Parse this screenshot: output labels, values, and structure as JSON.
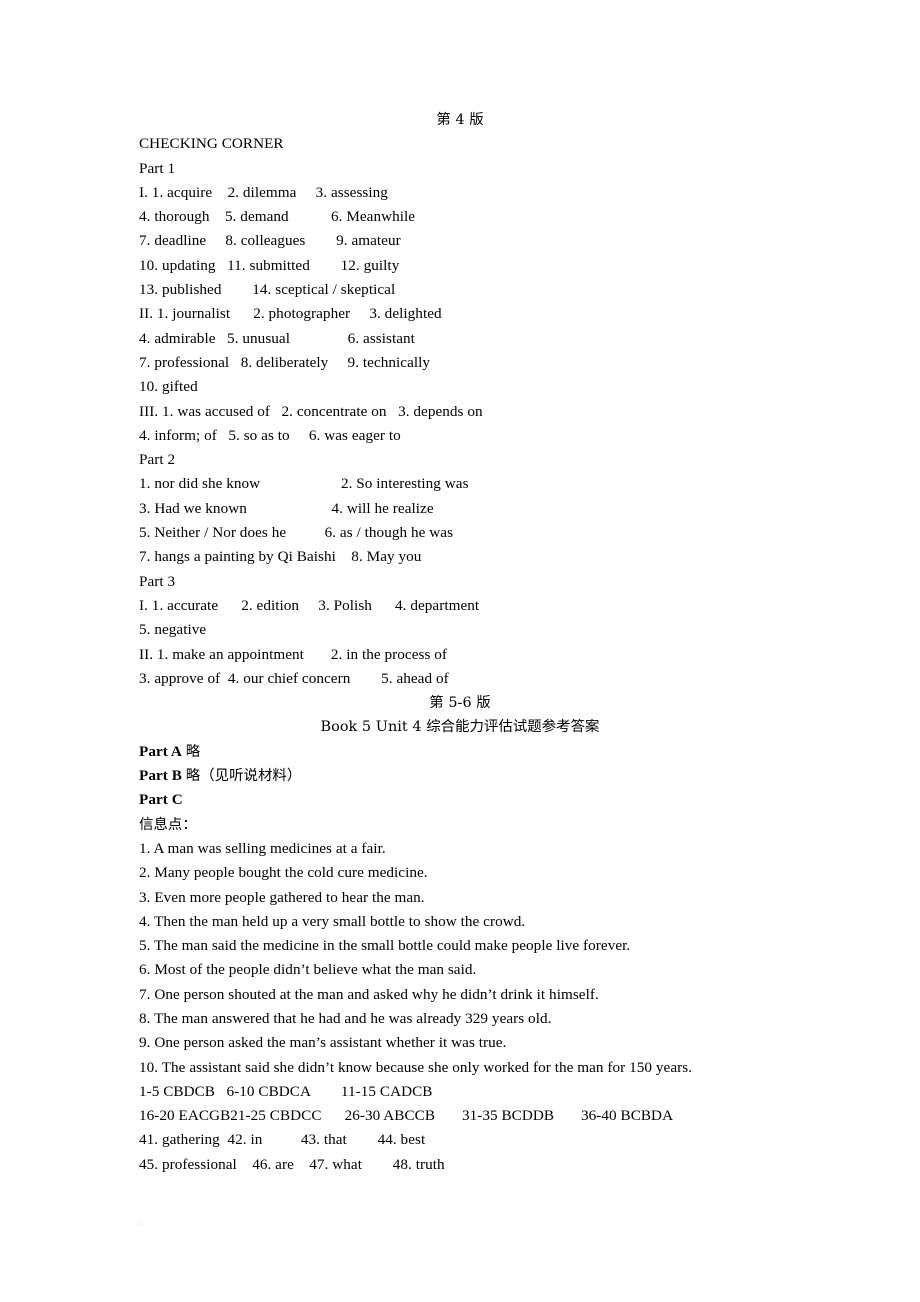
{
  "document": {
    "page_header_1": "第 4 版",
    "section_title": "CHECKING CORNER",
    "parts": {
      "part1_label": "Part 1",
      "part2_label": "Part 2",
      "part3_label": "Part 3"
    },
    "part1_lines": [
      "I. 1. acquire    2. dilemma     3. assessing",
      "4. thorough    5. demand           6. Meanwhile",
      "7. deadline     8. colleagues        9. amateur",
      "10. updating   11. submitted        12. guilty",
      "13. published        14. sceptical / skeptical",
      "II. 1. journalist      2. photographer     3. delighted",
      "4. admirable   5. unusual               6. assistant",
      "7. professional   8. deliberately     9. technically",
      "10. gifted",
      "III. 1. was accused of   2. concentrate on   3. depends on",
      "4. inform; of   5. so as to     6. was eager to"
    ],
    "part2_lines": [
      "1. nor did she know                     2. So interesting was",
      "3. Had we known                      4. will he realize",
      "5. Neither / Nor does he          6. as / though he was",
      "7. hangs a painting by Qi Baishi    8. May you"
    ],
    "part3_lines": [
      "I. 1. accurate      2. edition     3. Polish      4. department",
      "5. negative",
      "II. 1. make an appointment       2. in the process of",
      "3. approve of  4. our chief concern        5. ahead of"
    ],
    "page_header_2": "第 5-6 版",
    "exam_title": "Book 5 Unit 4 综合能力评估试题参考答案",
    "part_a_label": "Part A",
    "part_a_value": "略",
    "part_b_label": "Part B",
    "part_b_value": "略（见听说材料）",
    "part_c_label": "Part C",
    "info_points_label": "信息点：",
    "info_points": [
      "1. A man was selling medicines at a fair.",
      "2. Many people bought the cold cure medicine.",
      "3. Even more people gathered to hear the man.",
      "4. Then the man held up a very small bottle to show the crowd.",
      "5. The man said the medicine in the small bottle could make people live forever.",
      "6. Most of the people didn’t believe what the man said.",
      "7. One person shouted at the man and asked why he didn’t drink it himself.",
      "8. The man answered that he had and he was already 329 years old.",
      "9. One person asked the man’s assistant whether it was true.",
      "10. The assistant said she didn’t know because she only worked for the man for 150 years."
    ],
    "answer_key_lines": [
      "1-5 CBDCB   6-10 CBDCA        11-15 CADCB",
      "16-20 EACGB21-25 CBDCC      26-30 ABCCB       31-35 BCDDB       36-40 BCBDA",
      "41. gathering  42. in          43. that        44. best",
      "45. professional    46. are    47. what        48. truth"
    ]
  }
}
